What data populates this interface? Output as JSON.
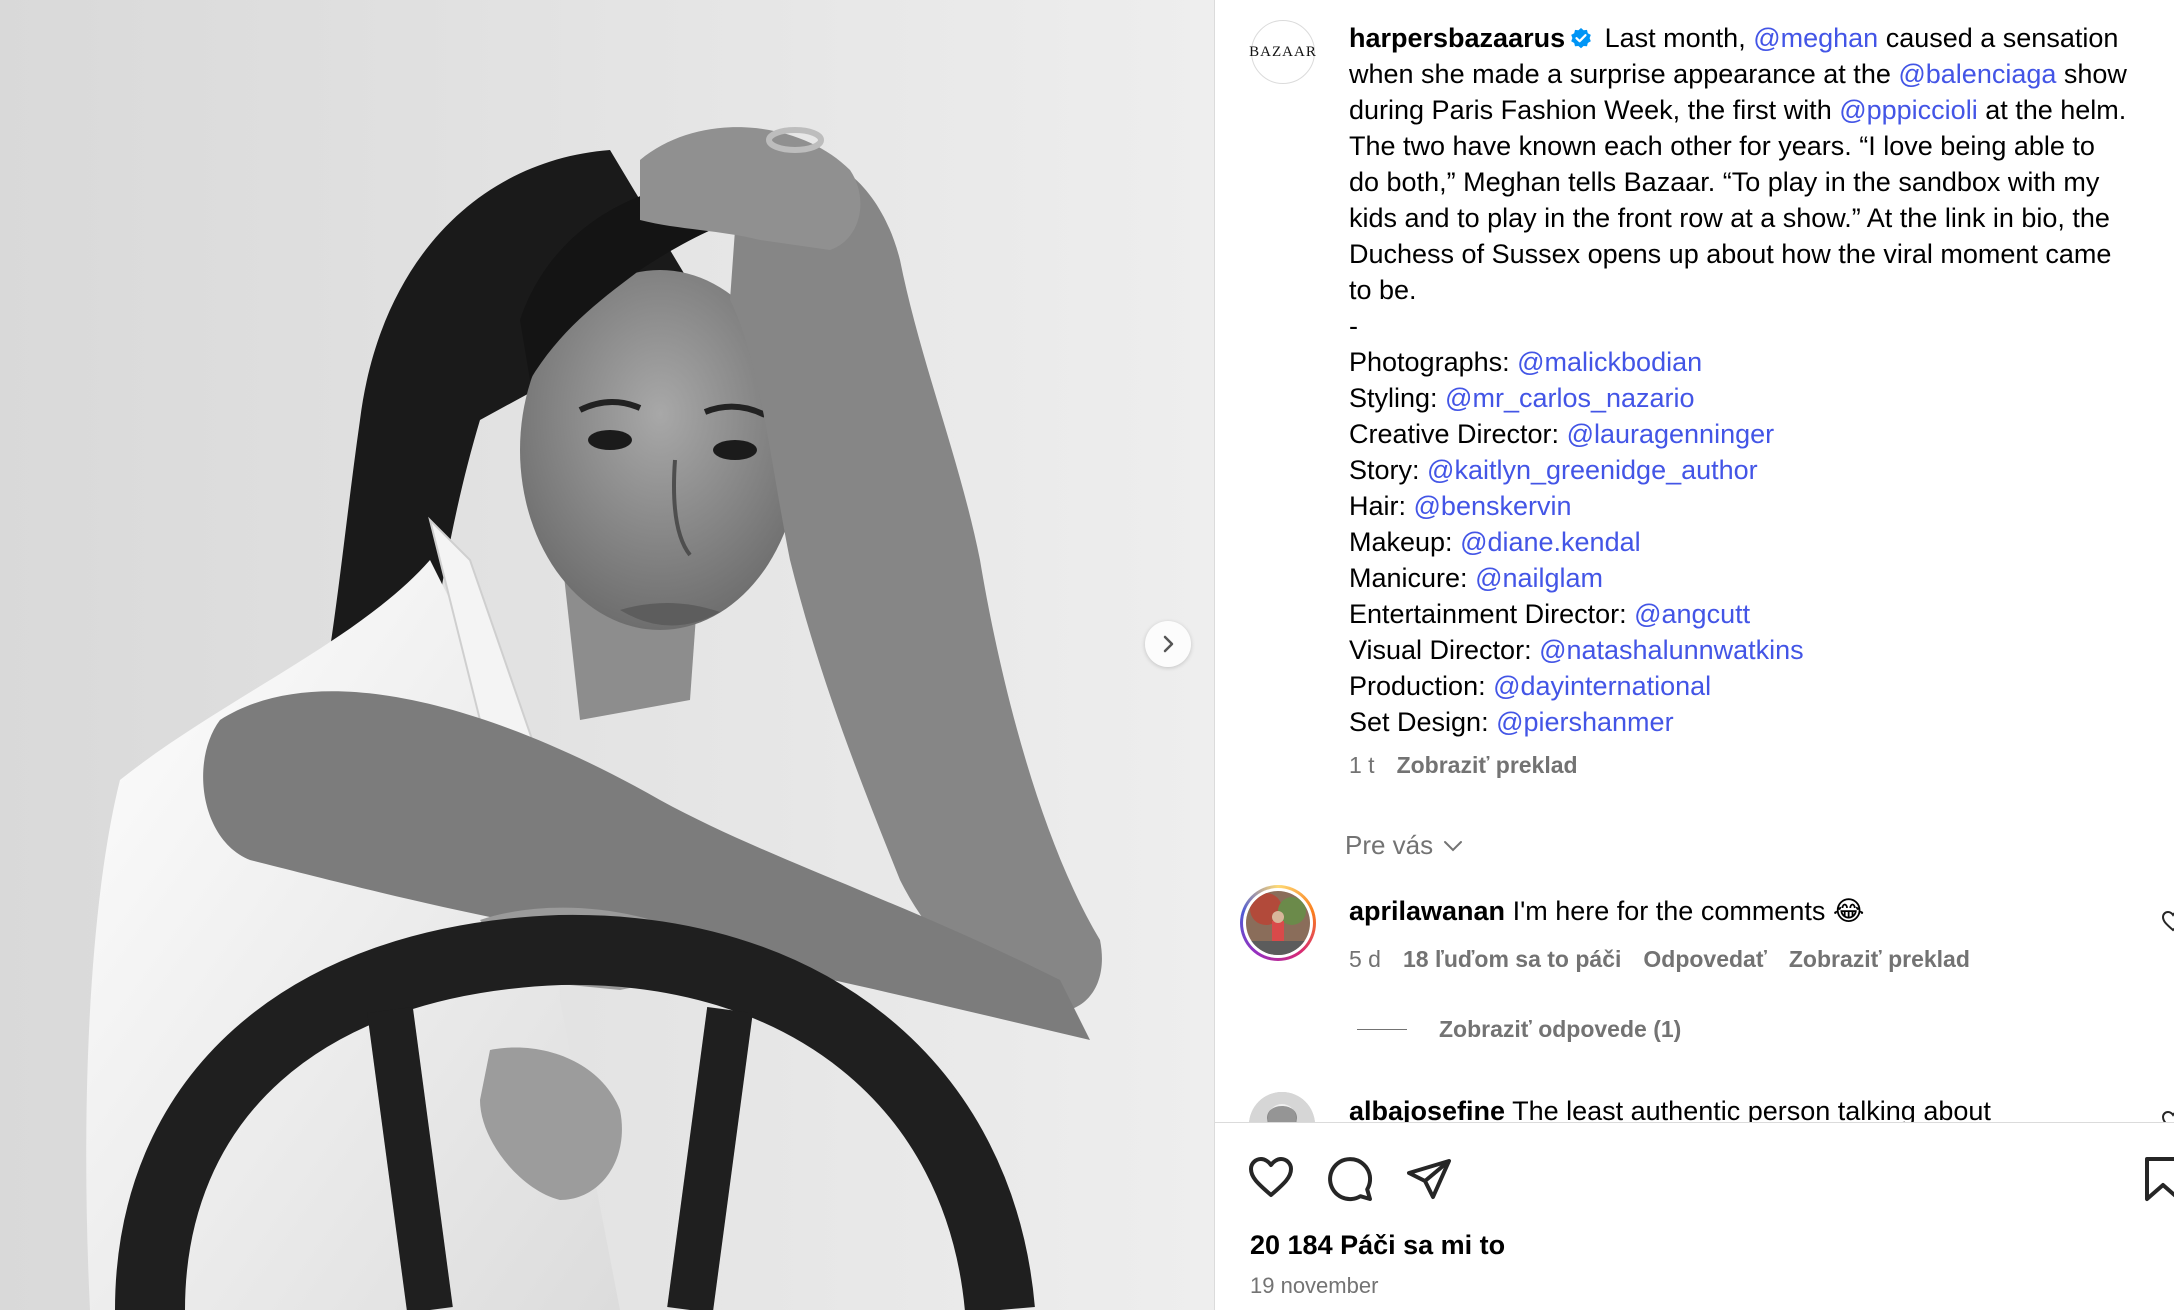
{
  "post": {
    "author": "harpersbazaarus",
    "avatar_text": "BAZAAR",
    "caption_lines": [
      [
        {
          "t": "Last month, "
        },
        {
          "t": "@meghan",
          "m": true
        },
        {
          "t": " caused a sensation"
        }
      ],
      [
        {
          "t": "when she made a surprise appearance at the "
        },
        {
          "t": "@balenciaga",
          "m": true
        },
        {
          "t": " show"
        }
      ],
      [
        {
          "t": "during Paris Fashion Week, the first with "
        },
        {
          "t": "@pppiccioli",
          "m": true
        },
        {
          "t": " at the helm."
        }
      ],
      [
        {
          "t": "The two have known each other for years. “I love being able to"
        }
      ],
      [
        {
          "t": "do both,” Meghan tells Bazaar. “To play in the sandbox with my"
        }
      ],
      [
        {
          "t": "kids and to play in the front row at a show.” At the link in bio, the"
        }
      ],
      [
        {
          "t": "Duchess of Sussex opens up about how the viral moment came"
        }
      ],
      [
        {
          "t": "to be."
        }
      ],
      [
        {
          "t": "-"
        }
      ],
      [
        {
          "t": "Photographs: "
        },
        {
          "t": "@malickbodian",
          "m": true
        }
      ],
      [
        {
          "t": "Styling: "
        },
        {
          "t": "@mr_carlos_nazario",
          "m": true
        }
      ],
      [
        {
          "t": "Creative Director: "
        },
        {
          "t": "@lauragenninger",
          "m": true
        }
      ],
      [
        {
          "t": "Story: "
        },
        {
          "t": "@kaitlyn_greenidge_author",
          "m": true
        }
      ],
      [
        {
          "t": "Hair: "
        },
        {
          "t": "@benskervin",
          "m": true
        }
      ],
      [
        {
          "t": "Makeup: "
        },
        {
          "t": "@diane.kendal",
          "m": true
        }
      ],
      [
        {
          "t": "Manicure: "
        },
        {
          "t": "@nailglam",
          "m": true
        }
      ],
      [
        {
          "t": "Entertainment Director: "
        },
        {
          "t": "@angcutt",
          "m": true
        }
      ],
      [
        {
          "t": "Visual Director: "
        },
        {
          "t": "@natashalunnwatkins",
          "m": true
        }
      ],
      [
        {
          "t": "Production: "
        },
        {
          "t": "@dayinternational",
          "m": true
        }
      ],
      [
        {
          "t": "Set Design: "
        },
        {
          "t": "@piershanmer",
          "m": true
        }
      ]
    ],
    "age": "1 t",
    "translate_label": "Zobraziť preklad",
    "likes": "20 184 Páči sa mi to",
    "date": "19 november"
  },
  "for_you_label": "Pre vás",
  "comments": [
    {
      "user": "aprilawanan",
      "text": "I'm here for the comments 😂",
      "age": "5 d",
      "likes": "18 ľuďom sa to páči",
      "reply_label": "Odpovedať",
      "translate_label": "Zobraziť preklad",
      "view_replies": "Zobraziť odpovede (1)"
    },
    {
      "user": "albajosefine",
      "text": "The least authentic person talking about"
    }
  ],
  "icons": {
    "like": "heart-icon",
    "comment": "comment-icon",
    "share": "send-icon",
    "save": "bookmark-icon",
    "next": "chevron-right-icon",
    "verified": "verified-badge-icon"
  },
  "colors": {
    "mention": "#4355e6",
    "secondary_text": "#737373",
    "verified": "#0095f6"
  }
}
